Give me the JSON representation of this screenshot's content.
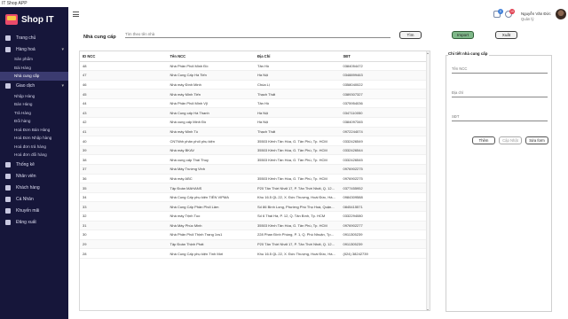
{
  "window": {
    "title": "IT Shop APP"
  },
  "brand": {
    "name": "Shop IT"
  },
  "sidebar": {
    "items": [
      {
        "label": "Trang chủ"
      },
      {
        "label": "Hàng hoá",
        "children": [
          "Sản phẩm",
          "Bài Hàng",
          "Nhà cung cấp"
        ]
      },
      {
        "label": "Giao dịch",
        "children": [
          "Nhập Hàng",
          "Bán Hàng",
          "Trả Hàng",
          "Đổi hàng",
          "Hoá Đơn Bán Hàng",
          "Hoá Đơn Nhập hàng",
          "Hoá đơn trả hàng",
          "Hoá đơn đổi hàng"
        ]
      },
      {
        "label": "Thống kê"
      },
      {
        "label": "Nhân viên"
      },
      {
        "label": "Khách hàng"
      },
      {
        "label": "Cá Nhân"
      },
      {
        "label": "Khuyến mãi"
      },
      {
        "label": "Đăng xuất"
      }
    ],
    "selected_sub": "Nhà cung cấp"
  },
  "header": {
    "cart_badge": "0",
    "notif_badge": "10",
    "user_name": "Nguyễn Văn Đức",
    "user_role": "Quản lý"
  },
  "toolbar": {
    "page_label": "Nhà cung cấp",
    "search_placeholder": "Tìm theo tên nhà",
    "search_button": "Tìm",
    "import_button": "Import",
    "export_button": "Xuất"
  },
  "table": {
    "columns": [
      "ID NCC",
      "Tên NCC",
      "Địa Chỉ",
      "SĐT"
    ],
    "rows": [
      [
        "48",
        "Nhà Phân Phối Minh Đồ",
        "Tân Hồ",
        "0384054472"
      ],
      [
        "47",
        "Nhà Cung Cấp Hà Tiến",
        "Hà Nội",
        "0348899463"
      ],
      [
        "46",
        "Nhà máy Đình Minh",
        "Chùa Lị",
        "0358040022"
      ],
      [
        "45",
        "Nhà máy Minh Tiến",
        "Thạch Thất",
        "0389307327"
      ],
      [
        "44",
        "Nhà Phân Phối Minh Vỹ",
        "Tân Hồ",
        "0375954036"
      ],
      [
        "43",
        "Nhà Cung cấp Hà Thanh",
        "Hà Nội",
        "0347110050"
      ],
      [
        "42",
        "Nhà cung cấp Minh Đồ",
        "Hà Nội",
        "0384097345"
      ],
      [
        "41",
        "Nhà máy Minh Tú",
        "Thạch Thất",
        "0972244074"
      ],
      [
        "40",
        "CNTNhh phân phối phụ kiện",
        "35503 Kênh Tân Hóa, G. Tân Phú, Tp. HCM",
        "0332426549"
      ],
      [
        "39",
        "Nhà máy BKAV",
        "35503 Kênh Tân Hóa, G. Tân Phú, Tp. HCM",
        "0332426544"
      ],
      [
        "38",
        "Nhà cung cấp Thái Thuỵ",
        "35503 Kênh Tân Hóa, G. Tân Phú, Tp. HCM",
        "0332426545"
      ],
      [
        "37",
        "Nhà Máy Trường Vinh",
        "",
        "0976902275"
      ],
      [
        "36",
        "Nhà máy ABC",
        "35503 Kênh Tân Hóa, G. Tân Phú, Tp. HCM",
        "0976902275"
      ],
      [
        "35",
        "Tập Đoàn MAHANS",
        "P20 Tân Thời Nhất 17, P. Tân Thới Nhất, Q. 12...",
        "0377455952"
      ],
      [
        "34",
        "Nhà Cung Cấp phụ kiện TIẾN VIPMA",
        "Khu 16.5 QL 22, X. Đức Thượng, Hoài Đức, Hà...",
        "0984309588"
      ],
      [
        "33",
        "Nhà Cung Cấp Phân Phối Lâm",
        "Số 86 Bình Long, Phường Phú Thọ Hoà, Quận...",
        "0845415571"
      ],
      [
        "32",
        "Nhà máy Trịnh Tuo",
        "Số 6 Thái Hà, P. 12, Q. Tân Bình, Tp. HCM",
        "0332294080"
      ],
      [
        "31",
        "Nhà Máy Phúc Minh",
        "35503 Kênh Tân Hóa, G. Tân Phú, Tp. HCM",
        "0976902277"
      ],
      [
        "30",
        "Nhà Phân Phối Thịnh Trang 1vs1",
        "228 Phan Đình Phùng, P. 1, Q. Phú Nhuận, Tp...",
        "0911305239"
      ],
      [
        "29",
        "Tập Đoàn Thịnh Phát",
        "P20 Tân Thời Nhất 17, P. Tân Thới Nhất, Q. 12...",
        "0911305239"
      ],
      [
        "28",
        "Nhà Cung Cấp phụ kiện Tính Mơi",
        "Khu 16.5 QL 22, X. Đức Thượng, Hoài Đức, Hà...",
        "(024) 38242739"
      ]
    ]
  },
  "detail": {
    "title": "Chi tiết nhà cung cấp",
    "name_placeholder": "Tên NCC",
    "address_placeholder": "Địa chỉ",
    "phone_placeholder": "SĐT",
    "add_button": "Thêm",
    "update_button": "Cập Nhật",
    "edit_button": "Sửa form"
  },
  "colors": {
    "sidebar_bg": "#16163a",
    "accent": "#e94a6a",
    "import_green": "#7fb889"
  }
}
